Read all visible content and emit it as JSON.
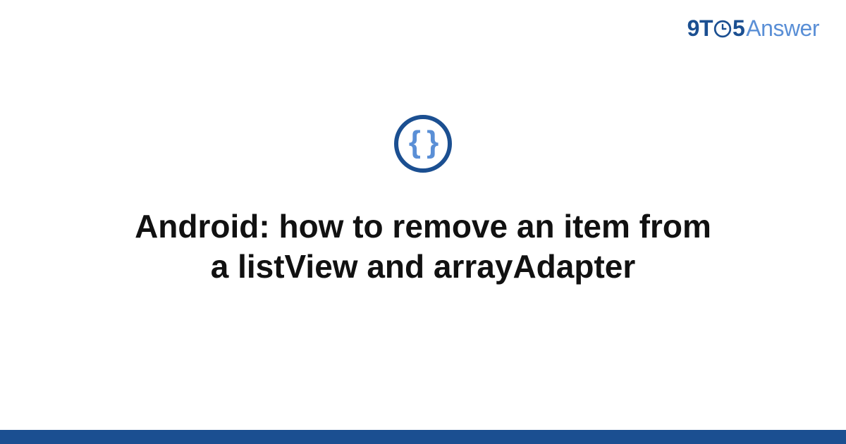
{
  "logo": {
    "part1": "9T",
    "part2": "5",
    "part3": "Answer"
  },
  "icon": {
    "glyph": "{ }",
    "name": "code-braces-icon"
  },
  "title": "Android: how to remove an item from a listView and arrayAdapter",
  "colors": {
    "primary": "#1b4f91",
    "accent": "#5a8fd6"
  }
}
